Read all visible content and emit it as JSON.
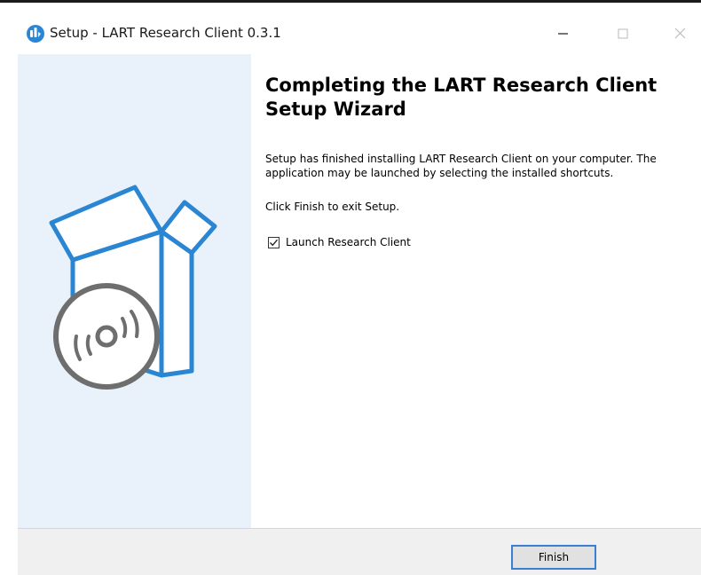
{
  "window": {
    "title": "Setup - LART Research Client 0.3.1",
    "app_icon": "setup-icon",
    "controls": {
      "minimize_icon": "minimize-icon",
      "maximize_icon": "maximize-icon",
      "close_icon": "close-icon"
    }
  },
  "sidepanel": {
    "illustration": "box-with-disc-icon",
    "accent_color": "#2a86d2",
    "disc_color": "#6e6e6e",
    "background_color": "#e9f1fa"
  },
  "main": {
    "heading": "Completing the LART Research Client Setup Wizard",
    "description": "Setup has finished installing LART Research Client on your computer. The application may be launched by selecting the installed shortcuts.",
    "exit_instruction": "Click Finish to exit Setup.",
    "launch_option": {
      "label": "Launch Research Client",
      "checked": true
    }
  },
  "footer": {
    "finish_label": "Finish",
    "button_border_color": "#3c7fd1"
  }
}
